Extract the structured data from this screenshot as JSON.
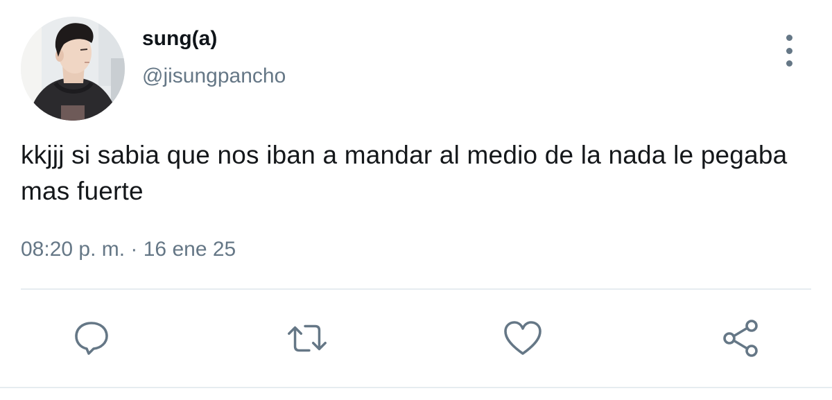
{
  "tweet": {
    "display_name": "sung(a)",
    "handle": "@jisungpancho",
    "text": "kkjjj si sabia que nos iban a mandar al medio de la nada le pegaba mas fuerte",
    "timestamp": "08:20 p. m. · 16 ene 25"
  },
  "icons": {
    "more": "more-vertical-icon",
    "reply": "reply-icon",
    "retweet": "retweet-icon",
    "like": "heart-icon",
    "share": "share-icon"
  },
  "colors": {
    "text": "#14171a",
    "secondary": "#657786",
    "divider": "#e6ecf0"
  }
}
